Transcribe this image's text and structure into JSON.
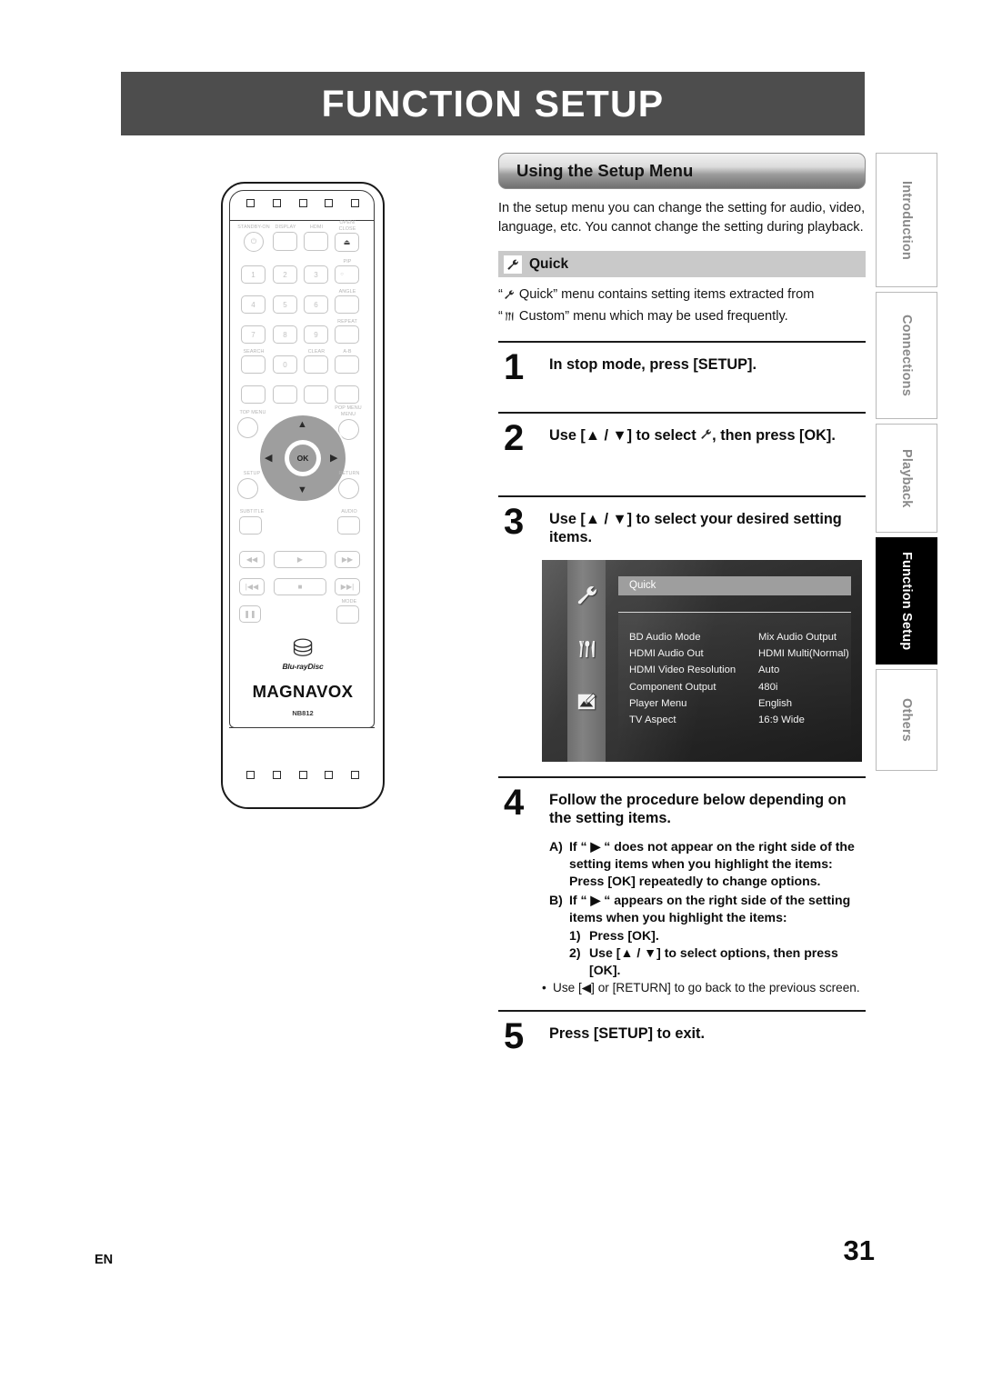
{
  "page": {
    "title": "FUNCTION SETUP",
    "language_code": "EN",
    "page_number": "31"
  },
  "side_tabs": [
    {
      "label": "Introduction",
      "active": false
    },
    {
      "label": "Connections",
      "active": false
    },
    {
      "label": "Playback",
      "active": false
    },
    {
      "label": "Function Setup",
      "active": true
    },
    {
      "label": "Others",
      "active": false
    }
  ],
  "section": {
    "heading": "Using the Setup Menu",
    "intro": "In the setup menu you can change the setting for audio, video, language, etc. You cannot change the setting during playback.",
    "quick_heading": "Quick",
    "quick_note_line1_pre": "“",
    "quick_note_line1_post": " Quick” menu contains setting items extracted from",
    "quick_note_line2_pre": "“",
    "quick_note_line2_post": " Custom” menu which may be used frequently."
  },
  "steps": [
    {
      "num": "1",
      "text": "In stop mode, press [SETUP]."
    },
    {
      "num": "2",
      "text_pre": "Use [▲ / ▼] to select ",
      "text_post": ", then press [OK]."
    },
    {
      "num": "3",
      "text": "Use [▲ / ▼] to select your desired setting items."
    },
    {
      "num": "4",
      "text": "Follow the procedure below depending on the setting items."
    },
    {
      "num": "5",
      "text": "Press [SETUP] to exit."
    }
  ],
  "procedure": {
    "a_marker": "A)",
    "a_text": "If “ ▶ “ does not appear on the right side of the setting items when you highlight the items:",
    "a_action": "Press [OK] repeatedly to change options.",
    "b_marker": "B)",
    "b_text": "If “ ▶ “ appears on the right side of the setting items when you highlight the items:",
    "b_1_marker": "1)",
    "b_1_text": "Press [OK].",
    "b_2_marker": "2)",
    "b_2_text": "Use [▲ / ▼] to select options, then press [OK].",
    "bullet_marker": "•",
    "bullet_text": "Use [◀] or [RETURN] to go back to the previous screen."
  },
  "tv_screen": {
    "menu_title": "Quick",
    "rows": [
      {
        "name": "BD Audio Mode",
        "value": "Mix Audio Output"
      },
      {
        "name": "HDMI Audio Out",
        "value": "HDMI Multi(Normal)"
      },
      {
        "name": "HDMI Video Resolution",
        "value": "Auto"
      },
      {
        "name": "Component Output",
        "value": "480i"
      },
      {
        "name": "Player Menu",
        "value": "English"
      },
      {
        "name": "TV Aspect",
        "value": "16:9 Wide"
      }
    ]
  },
  "remote": {
    "brand": "MAGNAVOX",
    "disc_logo_text": "Blu-rayDisc",
    "model": "NB812",
    "ok_label": "OK",
    "buttons": {
      "standby": "STANDBY-ON",
      "display": "DISPLAY",
      "hdmi": "HDMI",
      "open_close_1": "OPEN/",
      "open_close_2": "CLOSE",
      "pip": "PIP",
      "angle": "ANGLE",
      "repeat": "REPEAT",
      "search": "SEARCH",
      "clear": "CLEAR",
      "ab": "A-B",
      "top_menu": "TOP MENU",
      "pop_menu_1": "POP MENU",
      "pop_menu_2": "MENU",
      "setup": "SETUP",
      "return": "RETURN",
      "subtitle": "SUBTITLE",
      "audio": "AUDIO",
      "mode": "MODE",
      "n1": "1",
      "n2": "2",
      "n3": "3",
      "n4": "4",
      "n5": "5",
      "n6": "6",
      "n7": "7",
      "n8": "8",
      "n9": "9",
      "n0": "0"
    }
  },
  "colors": {
    "banner": "#4d4d4d",
    "quick_bar": "#c9c9c9",
    "active_tab": "#000000"
  }
}
